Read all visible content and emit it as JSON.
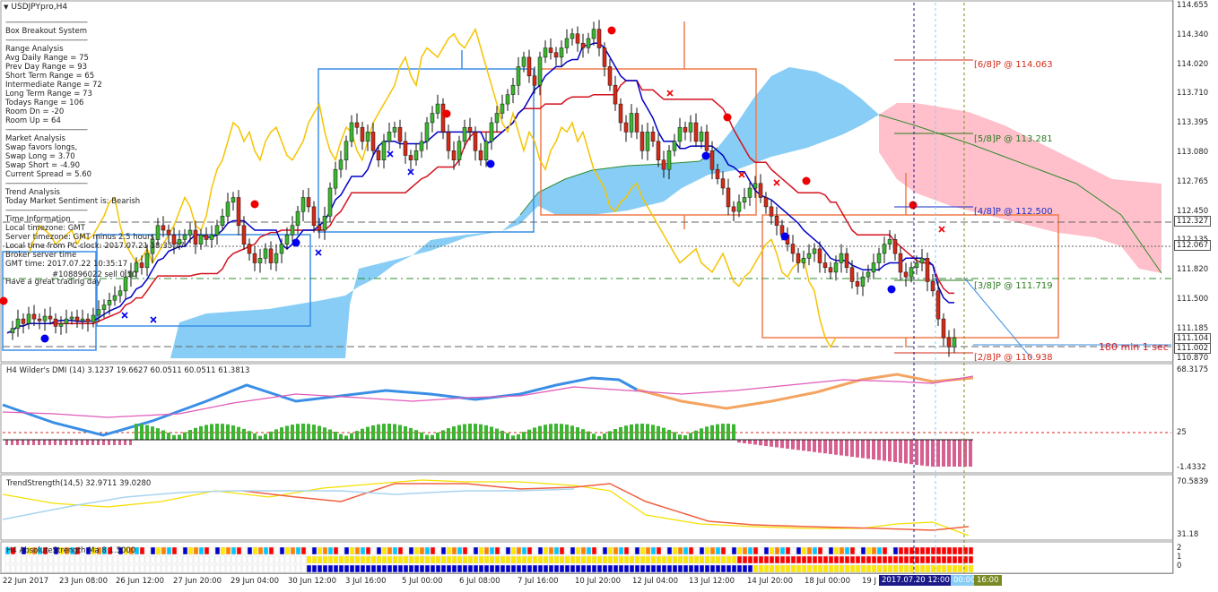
{
  "window": {
    "title": "USDJPYpro,H4"
  },
  "info_panel": {
    "lines": [
      "--------------------------------------------",
      "Box Breakout System",
      "--------------------------------------------",
      "Range Analysis",
      "Avg Daily Range = 75",
      "Prev Day Range = 93",
      "Short Term Range = 65",
      "Intermediate Range = 72",
      "Long Term Range = 73",
      "Todays Range = 106",
      "Room Dn = -20",
      "Room Up = 64",
      "--------------------------------------------",
      "Market Analysis",
      "Swap favors longs,",
      "Swap Long      = 3.70",
      "Swap Short    = -4.90",
      "Current Spread = 5.60",
      "--------------------------------------------",
      "Trend Analysis",
      "Today Market Sentiment is: Bearish",
      "--------------------------------------------",
      "Time Information",
      "Local timezone: GMT",
      "Server timezone: GMT minus 2.5 hours",
      "Local time from PC clock: 2017.07.21 18:35:17",
      "Broker server time",
      "GMT time: 2017.07.22 10:35:17",
      "",
      "Have a great trading day"
    ],
    "overlay_text": "#108896022 sell 0.50"
  },
  "price_axis": {
    "labels": [
      "114.655",
      "114.340",
      "114.020",
      "113.710",
      "113.395",
      "113.080",
      "112.765",
      "112.450",
      "112.135",
      "111.820",
      "111.500",
      "111.185",
      "110.870"
    ],
    "current_price": "111.104",
    "highlight_1": "112.327",
    "highlight_2": "112.067",
    "highlight_3": "111.002"
  },
  "levels": {
    "l6": "[6/8]P @ 114.063",
    "l5": "[5/8]P @ 113.281",
    "l4": "[4/8]P @ 112.500",
    "l3": "[3/8]P @ 111.719",
    "l2": "[2/8]P @ 110.938"
  },
  "countdown": "180 min 1 sec",
  "dmi": {
    "title": "H4 Wilder's DMI (14) 3.1237 19.6627 60.0511 60.0511 61.3813",
    "axis_top": "68.3175",
    "axis_mid": "25",
    "axis_bottom": "-1.4332"
  },
  "trend_strength": {
    "title": "TrendStrength(14,5) 32.9711 39.0280",
    "axis_top": "70.5839",
    "axis_bottom": "31.18"
  },
  "abs_strength": {
    "title": "H4 AbsoluteStrength Ma 8 1.5000",
    "axis": [
      "2",
      "1",
      "0"
    ]
  },
  "time_axis": {
    "labels": [
      "22 Jun 2017",
      "23 Jun 08:00",
      "26 Jun 12:00",
      "27 Jun 20:00",
      "29 Jun 04:00",
      "30 Jun 12:00",
      "3 Jul 16:00",
      "5 Jul 00:00",
      "6 Jul 08:00",
      "7 Jul 16:00",
      "10 Jul 20:00",
      "12 Jul 04:00",
      "13 Jul 12:00",
      "14 Jul 20:00",
      "18 Jul 00:00",
      "19 J"
    ],
    "highlight_date": "2017.07.20 12:00",
    "highlight_small": "00:00",
    "highlight_time": "16:00"
  },
  "colors": {
    "bull": "#3cb531",
    "bear": "#d42a18",
    "kijun": "#d4121f",
    "tenkan": "#0000c8",
    "chikou": "#f5c400",
    "kumo_bull": "#87cdf5",
    "kumo_bear": "#ffc0cb",
    "box_blue": "#3a8ee6",
    "box_orange": "#f07c4a"
  }
}
